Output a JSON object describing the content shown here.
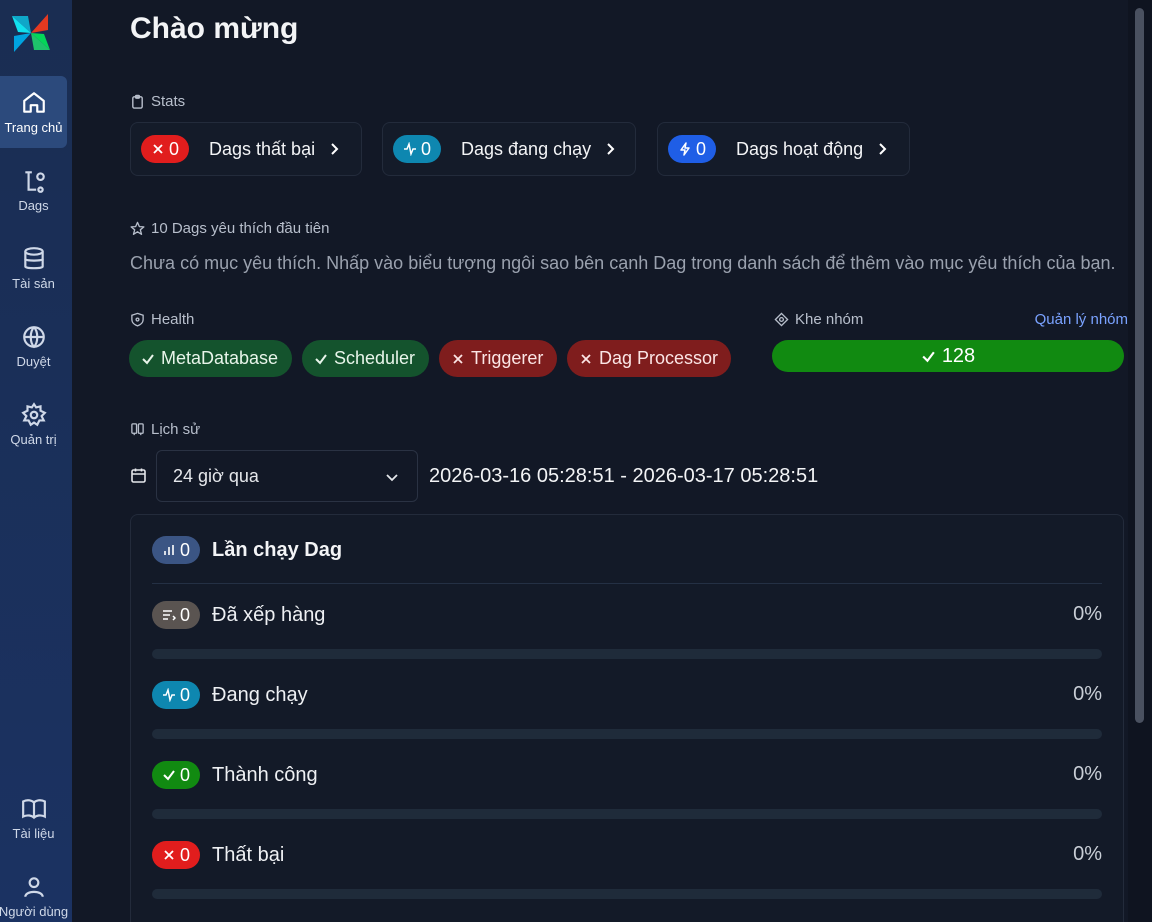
{
  "sidebar": {
    "items": [
      {
        "label": "Trang chủ",
        "icon": "home-icon",
        "active": true
      },
      {
        "label": "Dags",
        "icon": "dags-icon"
      },
      {
        "label": "Tài sản",
        "icon": "database-icon"
      },
      {
        "label": "Duyệt",
        "icon": "globe-icon"
      },
      {
        "label": "Quản trị",
        "icon": "gear-icon"
      }
    ],
    "bottom_items": [
      {
        "label": "Tài liệu",
        "icon": "book-icon"
      },
      {
        "label": "Người dùng",
        "icon": "user-icon"
      }
    ]
  },
  "page": {
    "title": "Chào mừng"
  },
  "stats": {
    "label": "Stats",
    "cards": [
      {
        "count": "0",
        "label": "Dags thất bại",
        "color": "#e11d1d",
        "icon": "x-icon"
      },
      {
        "count": "0",
        "label": "Dags đang chạy",
        "color": "#0e87b0",
        "icon": "activity-icon"
      },
      {
        "count": "0",
        "label": "Dags hoạt động",
        "color": "#1f5ee6",
        "icon": "zap-icon"
      }
    ]
  },
  "favorites": {
    "label": "10 Dags yêu thích đầu tiên",
    "empty_text": "Chưa có mục yêu thích. Nhấp vào biểu tượng ngôi sao bên cạnh Dag trong danh sách để thêm vào mục yêu thích của bạn."
  },
  "health": {
    "label": "Health",
    "badges": [
      {
        "label": "MetaDatabase",
        "status": "ok"
      },
      {
        "label": "Scheduler",
        "status": "ok"
      },
      {
        "label": "Triggerer",
        "status": "bad"
      },
      {
        "label": "Dag Processor",
        "status": "bad"
      }
    ]
  },
  "pools": {
    "label": "Khe nhóm",
    "manage_link": "Quản lý nhóm",
    "value": "128",
    "bar_color": "#118a11"
  },
  "history": {
    "label": "Lịch sử",
    "range_select": "24 giờ qua",
    "range_text": "2026-03-16 05:28:51 - 2026-03-17 05:28:51",
    "runs": {
      "title": "Lần chạy Dag",
      "count": "0",
      "color": "#3b5584"
    },
    "states": [
      {
        "name": "Đã xếp hàng",
        "count": "0",
        "percent": "0%",
        "fraction": 0,
        "color": "#5a5451",
        "icon": "queue-icon"
      },
      {
        "name": "Đang chạy",
        "count": "0",
        "percent": "0%",
        "fraction": 0,
        "color": "#0e87b0",
        "icon": "activity-icon"
      },
      {
        "name": "Thành công",
        "count": "0",
        "percent": "0%",
        "fraction": 0,
        "color": "#118a11",
        "icon": "check-icon"
      },
      {
        "name": "Thất bại",
        "count": "0",
        "percent": "0%",
        "fraction": 0,
        "color": "#e11d1d",
        "icon": "x-icon"
      }
    ]
  }
}
